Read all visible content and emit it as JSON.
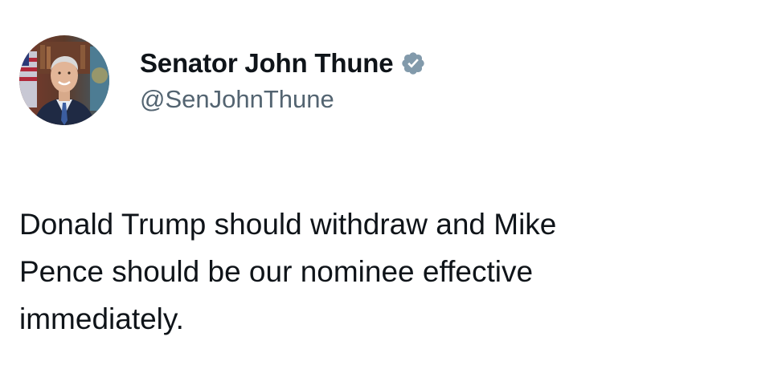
{
  "author": {
    "display_name": "Senator John Thune",
    "handle": "@SenJohnThune",
    "verified": true,
    "avatar_icon": "profile-photo"
  },
  "tweet": {
    "text": "Donald Trump should withdraw and Mike\nPence should be our nominee effective\nimmediately."
  },
  "colors": {
    "text": "#0f1419",
    "secondary_text": "#536471",
    "verified_badge": "#829aab",
    "background": "#ffffff"
  }
}
